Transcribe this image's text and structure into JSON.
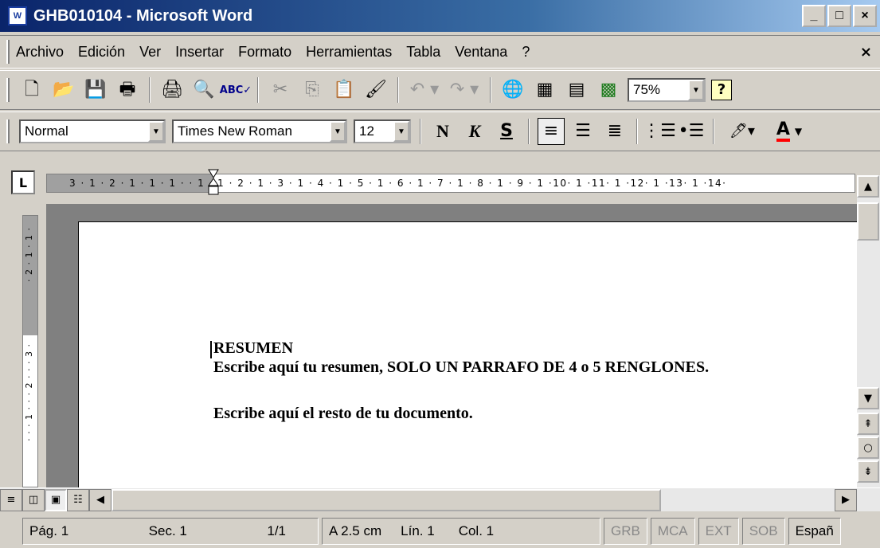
{
  "window": {
    "title": "GHB010104 - Microsoft Word",
    "app_icon": "word-document-icon",
    "buttons": {
      "minimize": "_",
      "maximize": "□",
      "close": "×"
    }
  },
  "menu": {
    "items": [
      "Archivo",
      "Edición",
      "Ver",
      "Insertar",
      "Formato",
      "Herramientas",
      "Tabla",
      "Ventana",
      "?"
    ],
    "close": "×"
  },
  "standard_toolbar": {
    "icons": [
      "new-document-icon",
      "open-folder-icon",
      "save-icon",
      "permission-icon",
      "print-icon",
      "print-preview-icon",
      "spelling-icon",
      "cut-icon",
      "copy-icon",
      "paste-icon",
      "format-painter-icon",
      "undo-icon",
      "redo-icon",
      "web-toolbar-icon",
      "tables-borders-icon",
      "insert-table-icon",
      "insert-excel-icon"
    ],
    "zoom": "75%",
    "help": "?"
  },
  "formatting_toolbar": {
    "style": "Normal",
    "font": "Times New Roman",
    "size": "12",
    "bold": "N",
    "italic": "K",
    "underline": "S",
    "icons": [
      "align-left-icon",
      "align-center-icon",
      "align-right-icon",
      "numbering-icon",
      "bullets-icon",
      "highlight-icon",
      "font-color-icon"
    ],
    "font_color_label": "A",
    "highlight_color": "#ffff00",
    "font_color": "#ff0000"
  },
  "ruler": {
    "tab_selector": "L",
    "horizontal_text": "3 · 1 · 2 · 1 · 1 · 1 · · 1 · 1 · 2 · 1 · 3 · 1 · 4 · 1 · 5 · 1 · 6 · 1 · 7 · 1 · 8 · 1 · 9 · 1 ·10· 1 ·11· 1 ·12· 1 ·13· 1 ·14·",
    "vertical_top": "· 2 · 1 · 1 ·",
    "vertical_bottom": "· · · 1 · · · 2 · · · 3 ·"
  },
  "document": {
    "line1": "RESUMEN",
    "line2": "Escribe aquí tu resumen, SOLO UN PARRAFO DE 4 o 5 RENGLONES.",
    "line3": "Escribe aquí el resto de tu documento."
  },
  "status": {
    "page": "Pág. 1",
    "section": "Sec. 1",
    "pages": "1/1",
    "at": "A 2.5 cm",
    "line": "Lín. 1",
    "column": "Col. 1",
    "grb": "GRB",
    "mca": "MCA",
    "ext": "EXT",
    "sob": "SOB",
    "language": "Españ"
  }
}
